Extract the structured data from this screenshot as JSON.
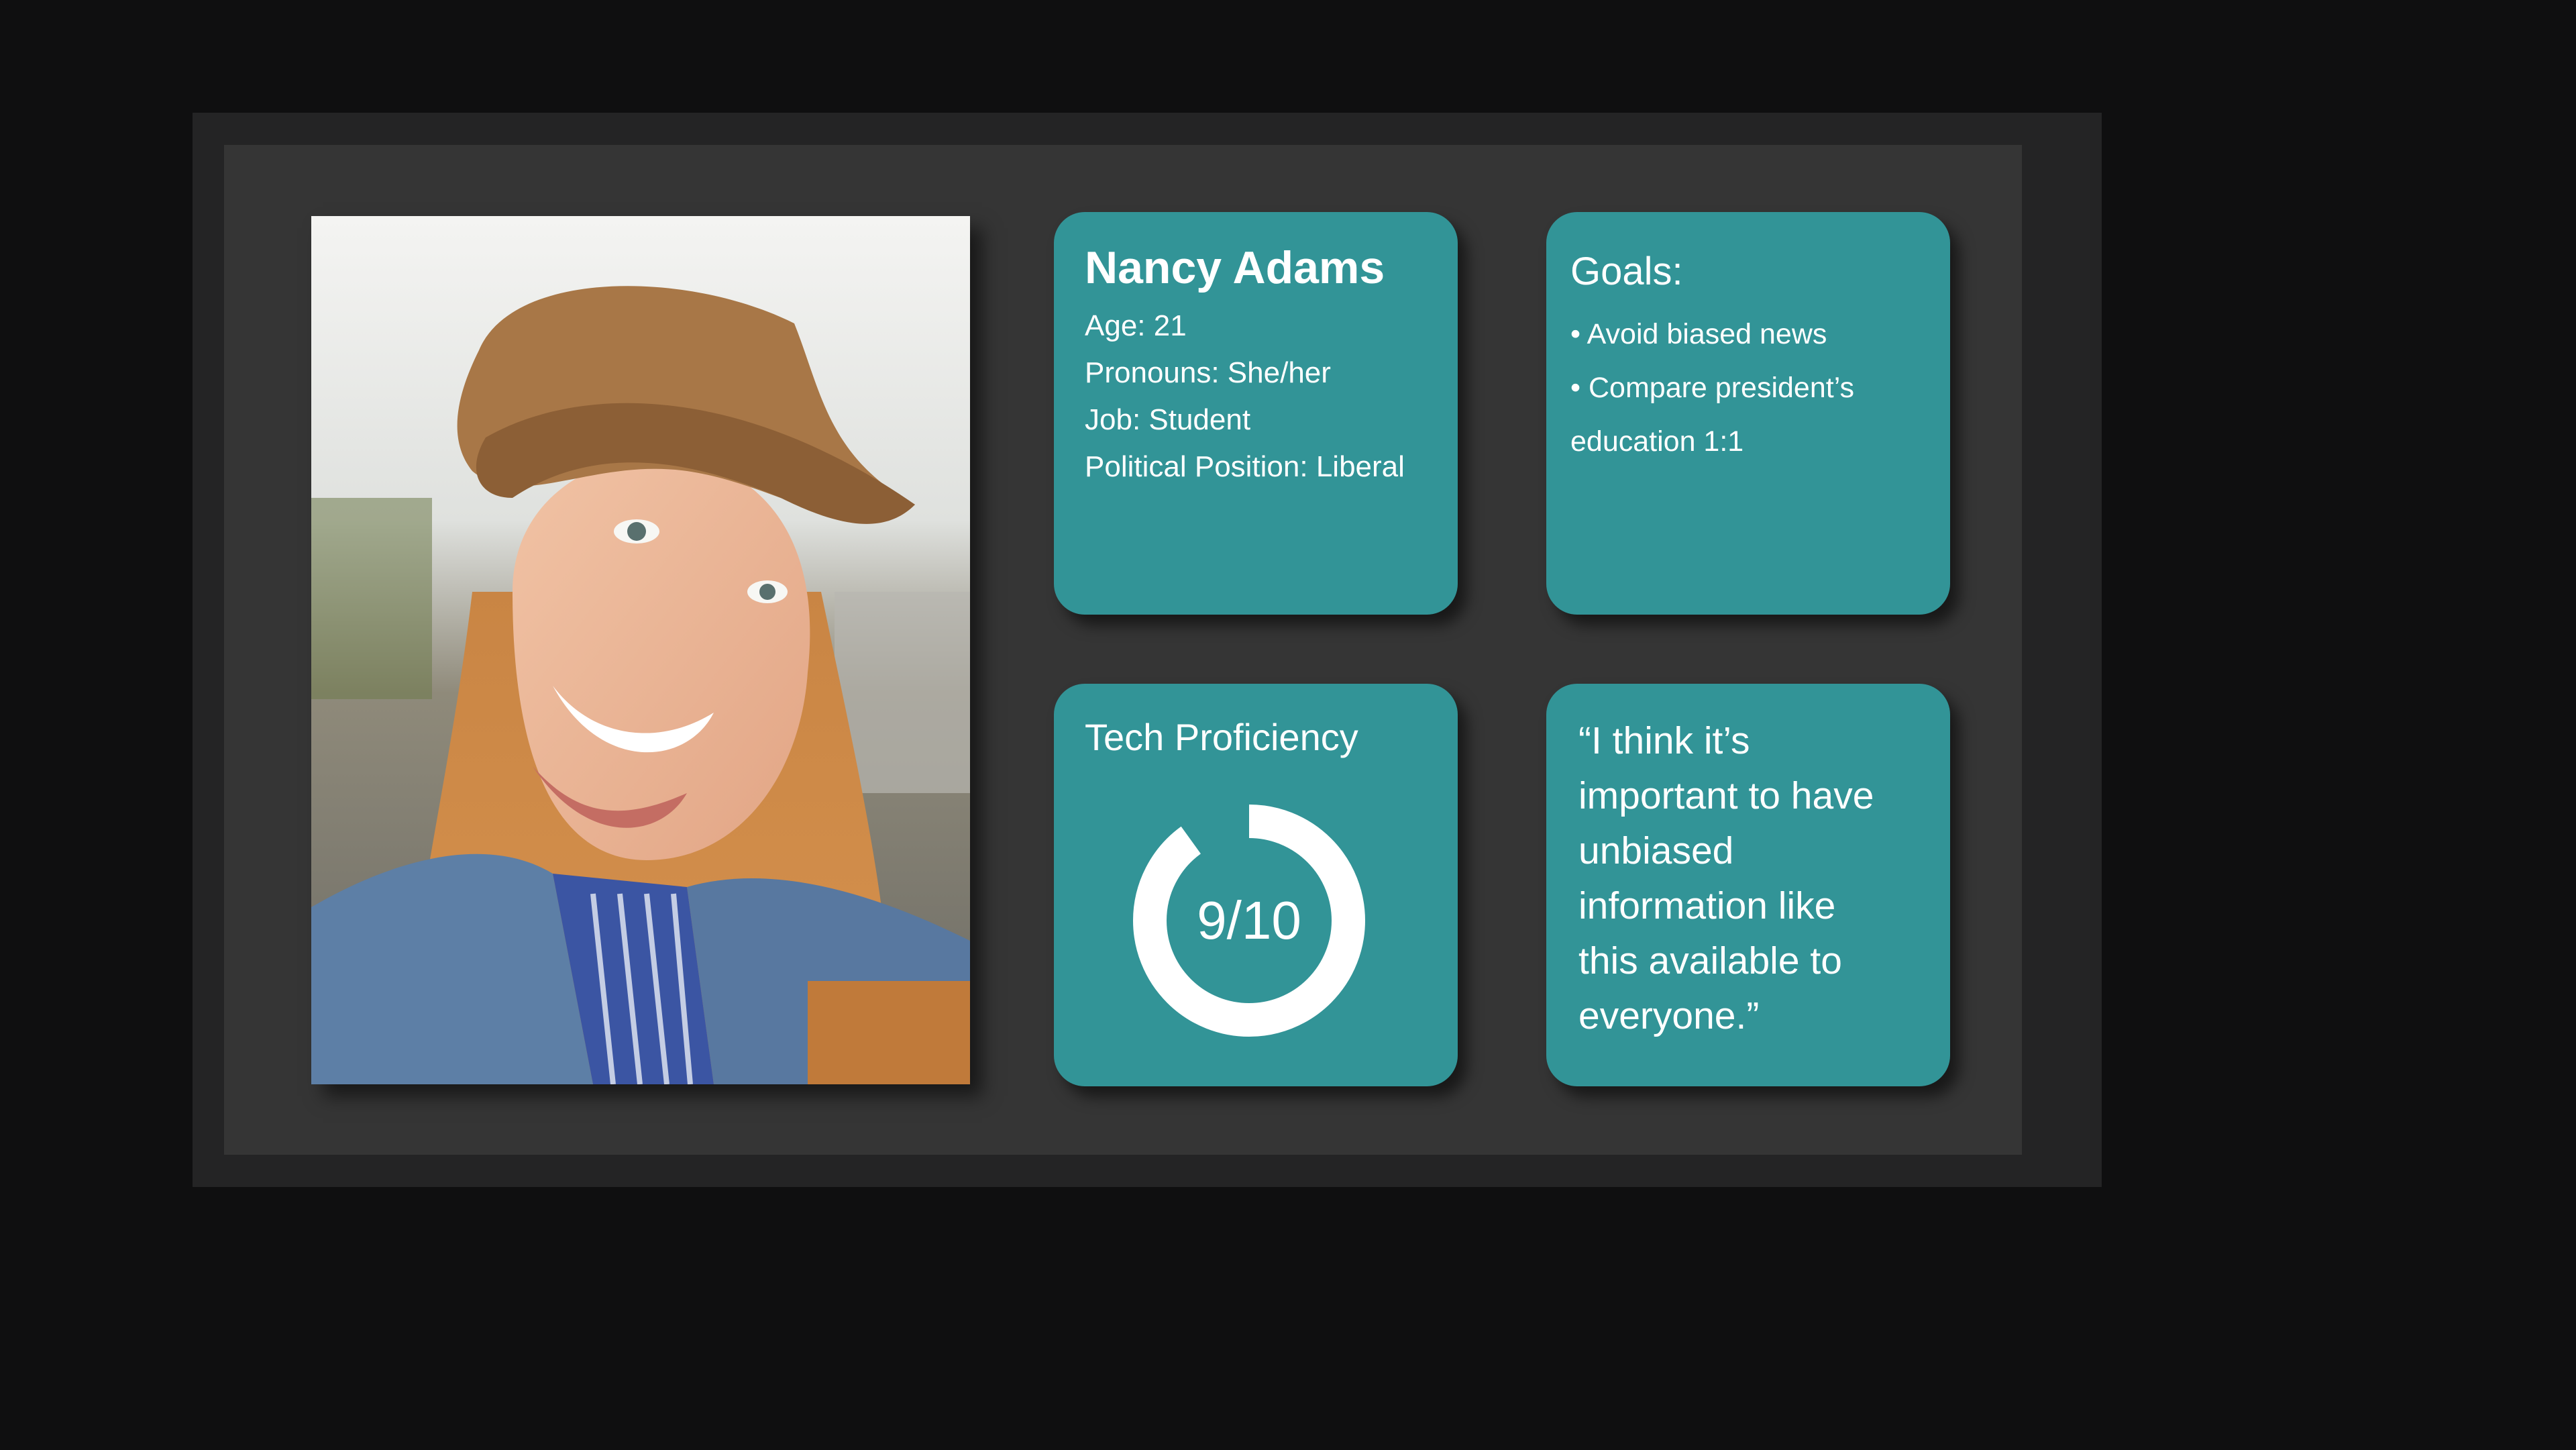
{
  "persona": {
    "name": "Nancy Adams",
    "facts": [
      "Age: 21",
      "Pronouns: She/her",
      "Job: Student",
      "Political Position: Liberal"
    ]
  },
  "goals": {
    "title": "Goals:",
    "items": [
      "• Avoid biased news",
      "• Compare president’s",
      "education 1:1"
    ]
  },
  "tech": {
    "title": "Tech Proficiency",
    "score_label": "9/10",
    "score_fraction": 0.9
  },
  "quote": {
    "lines": [
      "“I think it’s",
      "important to have",
      "unbiased",
      "information like",
      "this available to",
      "everyone.”"
    ]
  },
  "colors": {
    "card": "#329497",
    "slide": "#353535",
    "frame": "#242425",
    "background": "#0f0f10",
    "ring": "#ffffff"
  },
  "icons": [
    "portrait-photo"
  ]
}
